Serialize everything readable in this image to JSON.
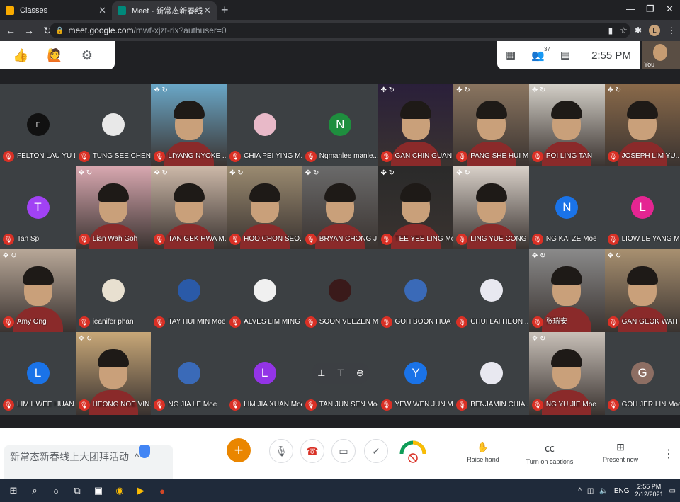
{
  "browser": {
    "tabs": [
      {
        "title": "Classes",
        "favicon_color": "#f9ab00"
      },
      {
        "title": "Meet - 新常态新春线上大团",
        "favicon_color": "#00897b"
      }
    ],
    "url_host": "meet.google.com",
    "url_path": "/mwf-xjzt-rix?authuser=0",
    "profile_letter": "L"
  },
  "meet": {
    "participants_count": "37",
    "time": "2:55 PM",
    "self_label": "You",
    "tiles": [
      {
        "name": "FELTON LAU YU L...",
        "kind": "avatar",
        "letter": "F",
        "color": "#111111"
      },
      {
        "name": "TUNG SEE CHEN...",
        "kind": "avatar",
        "letter": "",
        "color": "#e8e8e8"
      },
      {
        "name": "LIYANG NYOKE ...",
        "kind": "photo",
        "color": "#6aa8c8"
      },
      {
        "name": "CHIA PEI YING M...",
        "kind": "avatar",
        "letter": "",
        "color": "#e8b9c8"
      },
      {
        "name": "Ngmanlee manle...",
        "kind": "avatar",
        "letter": "N",
        "color": "#1e8e3e"
      },
      {
        "name": "GAN CHIN GUAN ...",
        "kind": "photo",
        "color": "#2a1f3a"
      },
      {
        "name": "PANG SHE HUI M...",
        "kind": "photo",
        "color": "#8a7560"
      },
      {
        "name": "POI LING TAN",
        "kind": "photo",
        "color": "#d4d0c8"
      },
      {
        "name": "JOSEPH LIM YU...",
        "kind": "photo",
        "color": "#8a6a4a"
      },
      {
        "name": "Tan Sp",
        "kind": "avatar",
        "letter": "T",
        "color": "#a142f4"
      },
      {
        "name": "Lian Wah Goh",
        "kind": "photo",
        "color": "#d8a8b0"
      },
      {
        "name": "TAN GEK HWA M...",
        "kind": "photo",
        "color": "#ccb8a8"
      },
      {
        "name": "HOO CHON SEO...",
        "kind": "photo",
        "color": "#9a8a70"
      },
      {
        "name": "BRYAN CHONG J...",
        "kind": "photo",
        "color": "#6a6a6a"
      },
      {
        "name": "TEE YEE LING Moe",
        "kind": "photo",
        "color": "#2a2a2a"
      },
      {
        "name": "LING YUE CONG ...",
        "kind": "photo",
        "color": "#d8d0c8"
      },
      {
        "name": "NG KAI ZE Moe",
        "kind": "avatar",
        "letter": "N",
        "color": "#1a73e8"
      },
      {
        "name": "LIOW LE YANG M...",
        "kind": "avatar",
        "letter": "L",
        "color": "#e52592"
      },
      {
        "name": "Amy Ong",
        "kind": "photo",
        "color": "#b8a898"
      },
      {
        "name": "jeanifer phan",
        "kind": "avatar",
        "letter": "",
        "color": "#e8e0d0"
      },
      {
        "name": "TAY HUI MIN Moe",
        "kind": "avatar",
        "letter": "",
        "color": "#2a5aa8"
      },
      {
        "name": "ALVES LIM MING ...",
        "kind": "avatar",
        "letter": "",
        "color": "#f0f0f0"
      },
      {
        "name": "SOON VEEZEN M...",
        "kind": "avatar",
        "letter": "",
        "color": "#3a1a1a"
      },
      {
        "name": "GOH BOON HUA ...",
        "kind": "avatar",
        "letter": "",
        "color": "#3a6ab8"
      },
      {
        "name": "CHUI LAI HEON ...",
        "kind": "avatar",
        "letter": "",
        "color": "#e8e8f0"
      },
      {
        "name": "张瑞安",
        "kind": "photo",
        "color": "#8a8a8a"
      },
      {
        "name": "GAN GEOK WAH ...",
        "kind": "photo",
        "color": "#a89070"
      },
      {
        "name": "LIM HWEE HUAN...",
        "kind": "avatar",
        "letter": "L",
        "color": "#1a73e8"
      },
      {
        "name": "HEONG NOE VIN...",
        "kind": "photo",
        "color": "#c8a878"
      },
      {
        "name": "NG JIA LE Moe",
        "kind": "avatar",
        "letter": "",
        "color": "#3a6ab8"
      },
      {
        "name": "LIM JIA XUAN Moe",
        "kind": "avatar",
        "letter": "L",
        "color": "#9334e6"
      },
      {
        "name": "TAN JUN SEN Moe",
        "kind": "blank",
        "letter": "",
        "color": "#3c4043"
      },
      {
        "name": "YEW WEN JUN M...",
        "kind": "avatar",
        "letter": "Y",
        "color": "#1a73e8"
      },
      {
        "name": "BENJAMIN CHIA ...",
        "kind": "avatar",
        "letter": "",
        "color": "#e8e8f0"
      },
      {
        "name": "NG YU JIE Moe",
        "kind": "photo",
        "color": "#c8c0b8"
      },
      {
        "name": "GOH JER LIN Moe",
        "kind": "avatar",
        "letter": "G",
        "color": "#8d6e63"
      }
    ],
    "notification": "新常态新春线上大团拜活动",
    "controls": {
      "raise_hand": "Raise hand",
      "captions": "Turn on captions",
      "present": "Present now"
    }
  },
  "taskbar": {
    "time": "2:55 PM",
    "date": "2/12/2021",
    "lang": "ENG"
  }
}
